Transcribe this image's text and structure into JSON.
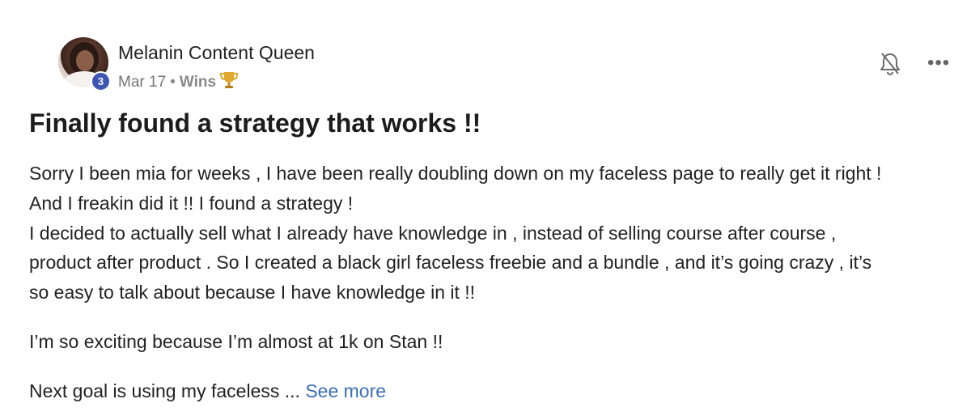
{
  "post": {
    "author": "Melanin Content Queen",
    "level": "3",
    "date": "Mar 17",
    "separator": "•",
    "category": "Wins",
    "category_icon": "trophy-icon",
    "title": "Finally found a strategy that works !!",
    "body_lines": [
      "Sorry I been mia for weeks , I have been really doubling down on my faceless page to really get it right !",
      "And I freakin did it !! I found a strategy !",
      "I decided to actually sell what I already have knowledge in , instead of selling course after course ,",
      "product after product . So I created a black girl faceless freebie and a bundle , and it’s going crazy , it’s",
      "so easy to talk about because I have knowledge in it !!"
    ],
    "paragraph_2": "I’m so exciting because I’m almost at 1k on Stan !!",
    "paragraph_3": "Next goal is using my faceless ...",
    "see_more": "See more",
    "more_menu": "•••"
  },
  "colors": {
    "level_badge": "#3d56b3",
    "link": "#3b6fb6",
    "meta_text": "#777777"
  }
}
